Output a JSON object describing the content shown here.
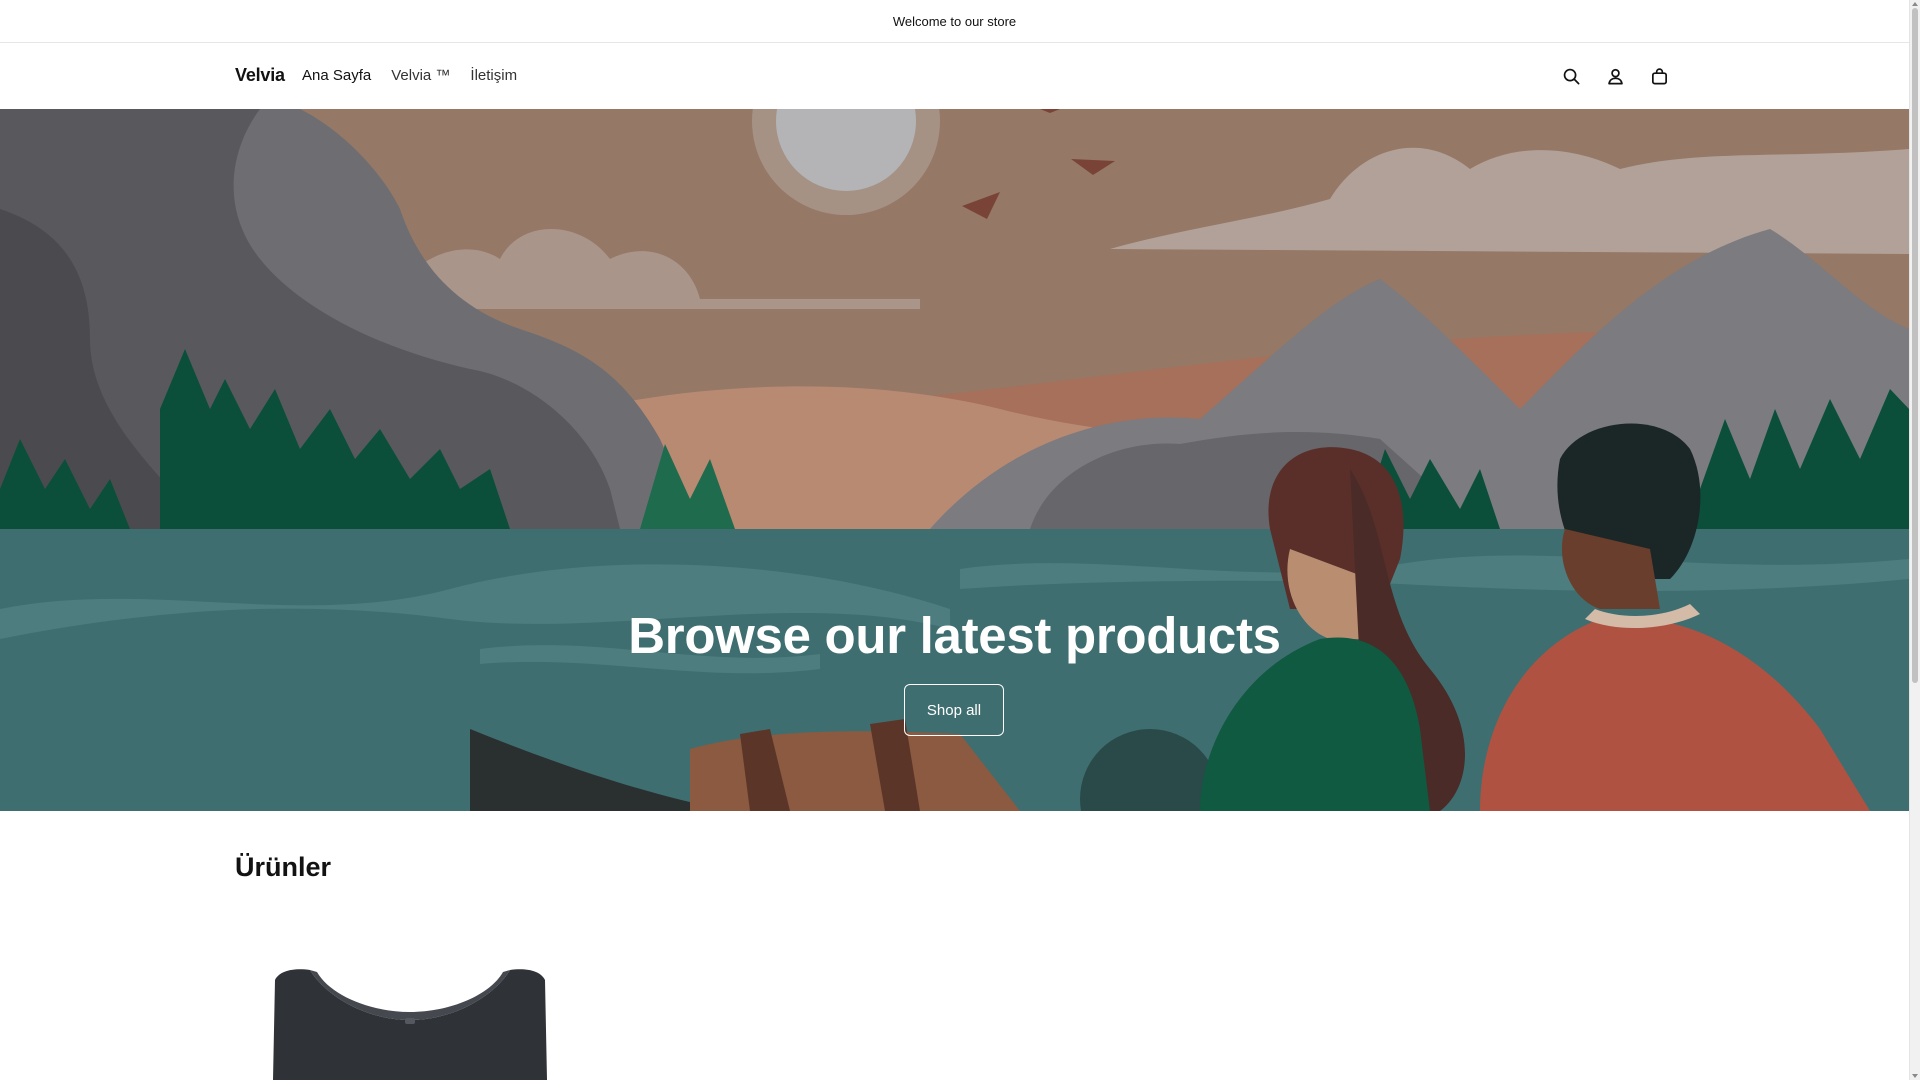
{
  "announcement": {
    "text": "Welcome to our store"
  },
  "header": {
    "brand": "Velvia",
    "nav": [
      "Ana Sayfa",
      "Velvia ™",
      "İletişim"
    ],
    "icons": [
      "search-icon",
      "account-icon",
      "cart-icon"
    ]
  },
  "hero": {
    "title": "Browse our latest products",
    "button_label": "Shop all"
  },
  "products": {
    "heading": "Ürünler"
  },
  "colors": {
    "sky": "#957866",
    "water": "#3f6e70",
    "text": "#121212",
    "hero_text": "#ffffff"
  }
}
